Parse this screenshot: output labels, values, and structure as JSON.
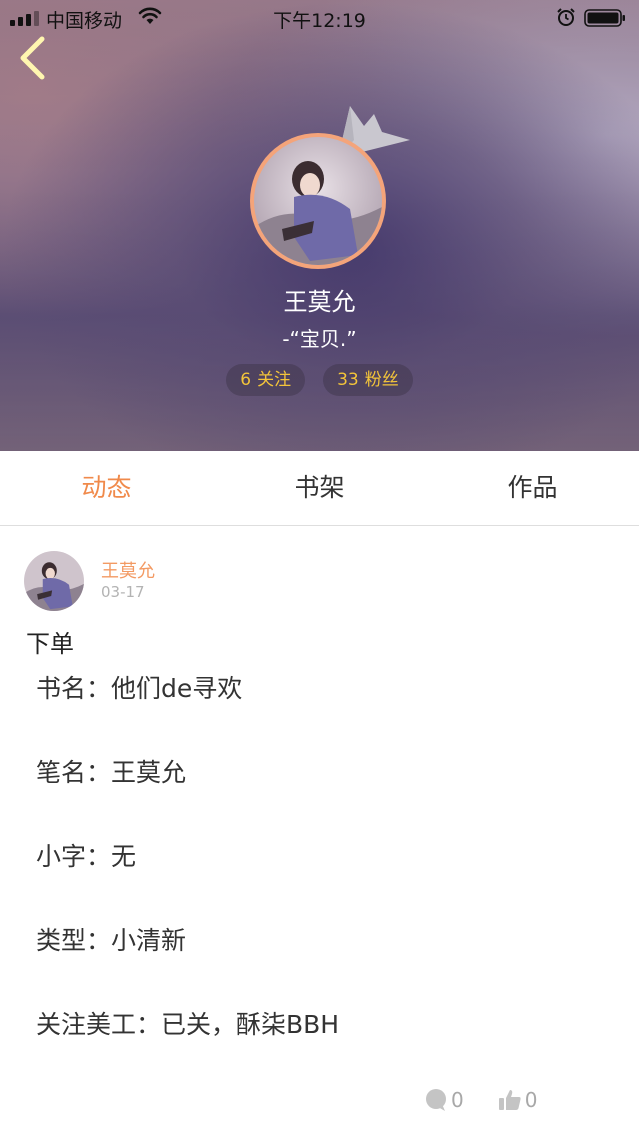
{
  "status_bar": {
    "carrier": "中国移动",
    "time": "下午12:19"
  },
  "profile": {
    "name": "王莫允",
    "motto": "-“宝贝.”",
    "following_count": "6",
    "following_label": "关注",
    "followers_count": "33",
    "followers_label": "粉丝"
  },
  "tabs": [
    {
      "label": "动态",
      "active": true
    },
    {
      "label": "书架",
      "active": false
    },
    {
      "label": "作品",
      "active": false
    }
  ],
  "post": {
    "author": "王莫允",
    "date": "03-17",
    "title": "下单",
    "lines": [
      "书名：他们de寻欢",
      "笔名：王莫允",
      "小字：无",
      "类型：小清新",
      "关注美工：已关，酥柒BBH"
    ],
    "comment_count": "0",
    "like_count": "0"
  },
  "colors": {
    "accent": "#f08a4b",
    "stat_text": "#f3c43a",
    "avatar_ring": "#f4a47a"
  },
  "icons": [
    "signal-icon",
    "wifi-icon",
    "alarm-icon",
    "battery-icon",
    "back-chevron-icon",
    "crown-icon",
    "comment-icon",
    "like-icon"
  ]
}
